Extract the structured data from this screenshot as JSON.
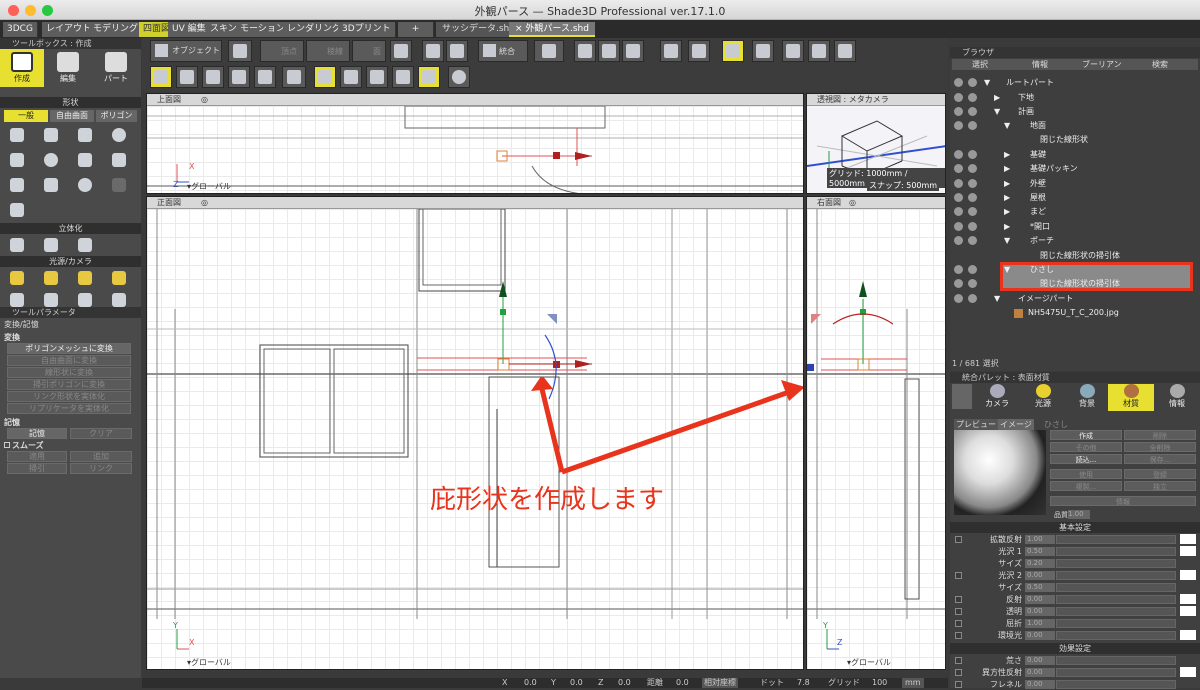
{
  "window": {
    "title": "外観パース — Shade3D Professional ver.17.1.0"
  },
  "mode_tabs": [
    "3DCG",
    "レイアウト",
    "モデリング",
    "四面図",
    "UV 編集",
    "スキン",
    "モーション",
    "レンダリング",
    "3Dプリント",
    "+"
  ],
  "doc_tabs": [
    "サッシデータ.shd",
    "× 外観パース.shd"
  ],
  "toolbox": {
    "header": "ツールボックス : 作成",
    "modes": [
      "作成",
      "編集",
      "パート"
    ],
    "shape_section": "形状",
    "shape_tabs": [
      "一般",
      "自由曲面",
      "ポリゴン"
    ],
    "solid_section": "立体化",
    "light_section": "光源/カメラ"
  },
  "tool_params": {
    "header": "ツールパラメータ",
    "transform_title": "変換/記憶",
    "transform_label": "変換",
    "buttons": [
      "ポリゴンメッシュに変換",
      "自由曲面に変換",
      "線形状に変換",
      "掃引ポリゴンに変換",
      "リンク形状を実体化",
      "リプリケータを実体化"
    ],
    "memory_label": "記憶",
    "mem_btns": [
      "記憶",
      "クリア"
    ],
    "smooth_label": "スムーズ",
    "smooth_btns": [
      "適用",
      "追加",
      "掃引",
      "リンク"
    ]
  },
  "toolbar": {
    "object_label": "オブジェクト",
    "vertex_label": "頂点",
    "edge_label": "稜線",
    "face_label": "面",
    "merge_label": "統合"
  },
  "viewports": {
    "top": {
      "title": "上面図",
      "global": "グローバル",
      "x": "X",
      "z": "Z"
    },
    "persp": {
      "title": "透視図 : メタカメラ",
      "grid": "グリッド: 1000mm / 5000mm",
      "snap": "スナップ: 500mm"
    },
    "front": {
      "title": "正面図",
      "global": "グローバル",
      "x": "X",
      "y": "Y"
    },
    "right": {
      "title": "右面図",
      "global": "グローバル",
      "z": "Z",
      "y": "Y"
    }
  },
  "annotation": {
    "text": "庇形状を作成します",
    "color": "#e8341c"
  },
  "status": {
    "x_label": "X",
    "x": "0.0",
    "y_label": "Y",
    "y": "0.0",
    "z_label": "Z",
    "z": "0.0",
    "dist_label": "距離",
    "dist": "0.0",
    "coord_mode": "相対座標",
    "dot_label": "ドット",
    "dot": "7.8",
    "grid_label": "グリッド",
    "grid": "100",
    "unit": "mm"
  },
  "browser": {
    "header": "ブラウザ",
    "tabs": [
      "選択",
      "情報",
      "ブーリアン",
      "検索"
    ],
    "tree": [
      "ルートパート",
      "下地",
      "計画",
      "地面",
      "閉じた線形状",
      "基礎",
      "基礎パッキン",
      "外壁",
      "屋根",
      "まど",
      "*開口",
      "ポーチ",
      "閉じた線形状の掃引体",
      "ひさし",
      "閉じた線形状の掃引体",
      "イメージパート",
      "NH5475U_T_C_200.jpg"
    ],
    "count": "1 / 681 選択"
  },
  "palette": {
    "header": "統合パレット : 表面材質",
    "tabs": [
      "カメラ",
      "光源",
      "背景",
      "材質",
      "情報"
    ],
    "sub_tabs": [
      "プレビュー",
      "イメージ",
      "ひさし"
    ],
    "side_buttons": [
      "作成",
      "削除",
      "その他",
      "全削除",
      "読込...",
      "保存...",
      "使用",
      "登録",
      "複製...",
      "独立"
    ],
    "info_btn": "情報",
    "quality_label": "品質",
    "quality": "1.00",
    "basic_section": "基本設定",
    "props": [
      {
        "name": "拡散反射",
        "val": "1.00"
      },
      {
        "name": "光沢 1",
        "val": "0.50"
      },
      {
        "name": "サイズ",
        "val": "0.20"
      },
      {
        "name": "光沢 2",
        "val": "0.00"
      },
      {
        "name": "サイズ",
        "val": "0.50"
      },
      {
        "name": "反射",
        "val": "0.00"
      },
      {
        "name": "透明",
        "val": "0.00"
      },
      {
        "name": "屈折",
        "val": "1.00"
      },
      {
        "name": "環境光",
        "val": "0.00"
      }
    ],
    "effect_section": "効果設定",
    "effects": [
      {
        "name": "荒さ",
        "val": "0.00"
      },
      {
        "name": "異方性反射",
        "val": "0.00"
      },
      {
        "name": "フレネル",
        "val": "0.00"
      }
    ]
  }
}
